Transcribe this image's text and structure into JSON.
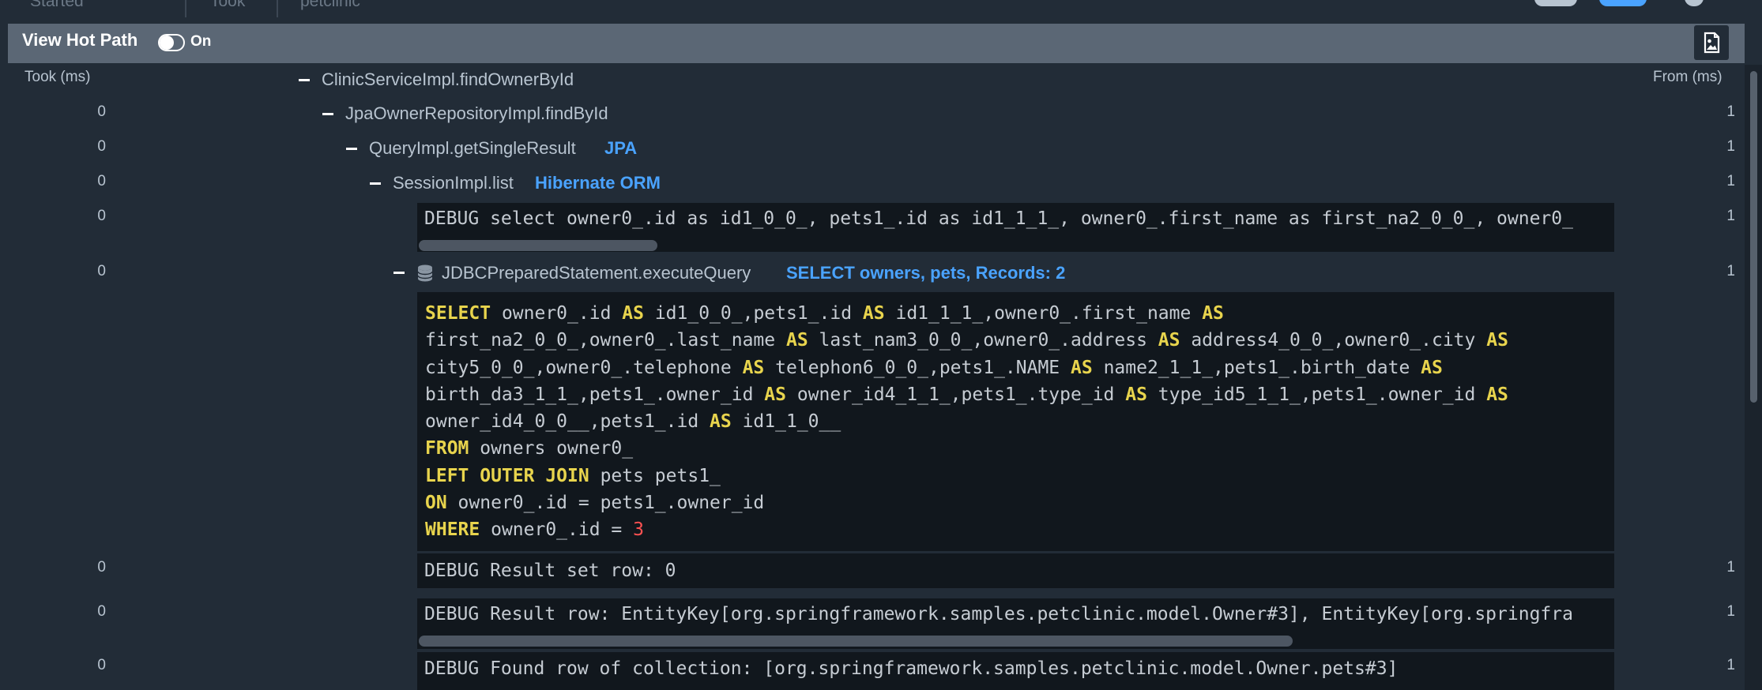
{
  "top": {
    "started_label": "Started",
    "took_label": "Took",
    "app_label": "petclinic"
  },
  "header": {
    "title": "View Hot Path",
    "toggle_label": "On",
    "export_icon": "image-export-icon"
  },
  "columns": {
    "took": "Took (ms)",
    "from": "From (ms)"
  },
  "rows": [
    {
      "took": "",
      "method": "ClinicServiceImpl.findOwnerById",
      "tag": "",
      "from": ""
    },
    {
      "took": "0",
      "method": "JpaOwnerRepositoryImpl.findById",
      "tag": "",
      "from": "1"
    },
    {
      "took": "0",
      "method": "QueryImpl.getSingleResult",
      "tag": "JPA",
      "from": "1"
    },
    {
      "took": "0",
      "method": "SessionImpl.list",
      "tag": "Hibernate ORM",
      "from": "1"
    },
    {
      "took": "0",
      "log": "DEBUG select owner0_.id as id1_0_0_, pets1_.id as id1_1_1_, owner0_.first_name as first_na2_0_0_, owner0_",
      "from": "1"
    },
    {
      "took": "0",
      "method": "JDBCPreparedStatement.executeQuery",
      "tag": "SELECT owners, pets, Records: 2",
      "from": "1"
    },
    {
      "took": "0",
      "log": "DEBUG Result set row: 0",
      "from": "1"
    },
    {
      "took": "0",
      "log": "DEBUG Result row: EntityKey[org.springframework.samples.petclinic.model.Owner#3], EntityKey[org.springfra",
      "from": "1"
    },
    {
      "took": "0",
      "log": "DEBUG Found row of collection: [org.springframework.samples.petclinic.model.Owner.pets#3]",
      "from": "1"
    }
  ],
  "sql": {
    "l1_kw1": "SELECT",
    "l1_t1": " owner0_.id ",
    "l1_kw2": "AS",
    "l1_t2": " id1_0_0_,pets1_.id ",
    "l1_kw3": "AS",
    "l1_t3": " id1_1_1_,owner0_.first_name ",
    "l1_kw4": "AS",
    "l2_t1": "first_na2_0_0_,owner0_.last_name ",
    "l2_kw1": "AS",
    "l2_t2": " last_nam3_0_0_,owner0_.address ",
    "l2_kw2": "AS",
    "l2_t3": " address4_0_0_,owner0_.city ",
    "l2_kw3": "AS",
    "l3_t1": "city5_0_0_,owner0_.telephone ",
    "l3_kw1": "AS",
    "l3_t2": " telephon6_0_0_,pets1_.NAME ",
    "l3_kw2": "AS",
    "l3_t3": " name2_1_1_,pets1_.birth_date ",
    "l3_kw3": "AS",
    "l4_t1": "birth_da3_1_1_,pets1_.owner_id ",
    "l4_kw1": "AS",
    "l4_t2": " owner_id4_1_1_,pets1_.type_id ",
    "l4_kw2": "AS",
    "l4_t3": " type_id5_1_1_,pets1_.owner_id ",
    "l4_kw3": "AS",
    "l5_t1": "owner_id4_0_0__,pets1_.id ",
    "l5_kw1": "AS",
    "l5_t2": " id1_1_0__",
    "l6_kw1": "FROM",
    "l6_t1": " owners owner0_",
    "l7_kw1": "LEFT OUTER JOIN",
    "l7_t1": " pets pets1_",
    "l8_kw1": "ON",
    "l8_t1": " owner0_.id = pets1_.owner_id",
    "l9_kw1": "WHERE",
    "l9_t1": " owner0_.id = ",
    "l9_num": "3"
  },
  "colors": {
    "background": "#222c37",
    "header": "#5b6775",
    "accent_blue": "#4aa3ff",
    "sql_keyword": "#e8d44d",
    "sql_number": "#ff5252"
  }
}
